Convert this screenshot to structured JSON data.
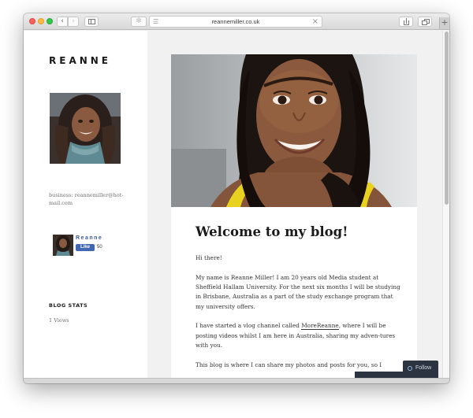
{
  "browser": {
    "url": "reannemiller.co.uk",
    "new_tab_label": "+",
    "back_label": "‹",
    "forward_label": "›"
  },
  "sidebar": {
    "site_title": "REANNE",
    "business_email": "business: reannemiller@hot-mail.com",
    "facebook": {
      "name": "Reanne",
      "like_label": "Like",
      "like_count": "50"
    },
    "stats": {
      "heading": "BLOG STATS",
      "views": "1 Views"
    }
  },
  "post": {
    "title": "Welcome to my blog!",
    "paragraphs": {
      "p1": "Hi there!",
      "p2": "My name is Reanne Miller! I am 20 years old Media student at Sheffield Hallam University. For the next six months I will be studying in Brisbane, Australia as a part of the study exchange program that my university offers.",
      "p3_before": "I have started a vlog channel called ",
      "p3_link": "MoreReanne",
      "p3_after": ", where I will be posting videos whilst I am here in Australia, sharing my adven-tures with you.",
      "p4": "This blog is where I can share my photos and posts for you, so I"
    }
  },
  "follow": {
    "label": "Follow"
  },
  "colors": {
    "facebook_blue": "#4267b2",
    "follow_bg": "#2b3440"
  }
}
